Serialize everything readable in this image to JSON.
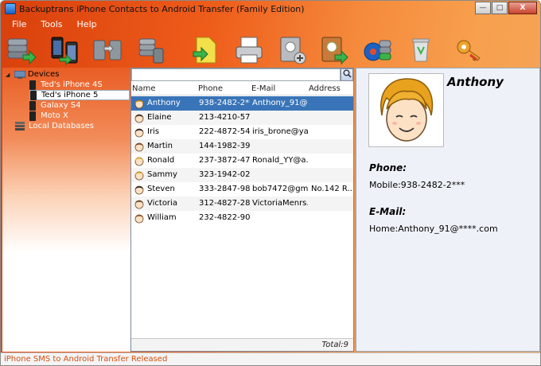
{
  "window": {
    "title": "Backuptrans iPhone Contacts to Android Transfer (Family Edition)",
    "controls": {
      "minimize": "—",
      "maximize": "□",
      "close": "X"
    }
  },
  "menu": [
    "File",
    "Tools",
    "Help"
  ],
  "toolbar": [
    "backup-database-icon",
    "transfer-to-android-icon",
    "sync-devices-icon",
    "import-database-icon",
    "export-file-icon",
    "print-icon",
    "add-contact-icon",
    "export-contacts-icon",
    "restore-icon",
    "trash-icon",
    "key-icon"
  ],
  "tree": {
    "devices_label": "Devices",
    "devices": [
      "Ted's iPhone 4S",
      "Ted's iPhone 5",
      "Galaxy S4",
      "Moto X"
    ],
    "selected": "Ted's iPhone 5",
    "local_label": "Local Databases"
  },
  "list": {
    "search_value": "",
    "columns": {
      "name": "Name",
      "phone": "Phone",
      "email": "E-Mail",
      "address": "Address"
    },
    "rows": [
      {
        "name": "Anthony",
        "phone": "938-2482-2***",
        "email": "Anthony_91@*...",
        "address": ""
      },
      {
        "name": "Elaine",
        "phone": "213-4210-57...",
        "email": "",
        "address": ""
      },
      {
        "name": "Iris",
        "phone": "222-4872-54...",
        "email": "iris_brone@ya...",
        "address": ""
      },
      {
        "name": "Martin",
        "phone": "144-1982-39...",
        "email": "",
        "address": ""
      },
      {
        "name": "Ronald",
        "phone": "237-3872-47...",
        "email": "Ronald_YY@a...",
        "address": ""
      },
      {
        "name": "Sammy",
        "phone": "323-1942-02...",
        "email": "",
        "address": ""
      },
      {
        "name": "Steven",
        "phone": "333-2847-98...",
        "email": "bob7472@gm...",
        "address": "No.142 R..."
      },
      {
        "name": "Victoria",
        "phone": "312-4827-28...",
        "email": "VictoriaMenrs...",
        "address": ""
      },
      {
        "name": "William",
        "phone": "232-4822-90...",
        "email": "",
        "address": ""
      }
    ],
    "total": "Total:9"
  },
  "detail": {
    "name": "Anthony",
    "phone_label": "Phone:",
    "phone_value": "Mobile:938-2482-2***",
    "email_label": "E-Mail:",
    "email_value": "Home:Anthony_91@****.com"
  },
  "status": "iPhone SMS to Android Transfer Released",
  "colors": {
    "accent": "#ee5c1a",
    "selection": "#3974b8",
    "status_text": "#d44f12"
  }
}
